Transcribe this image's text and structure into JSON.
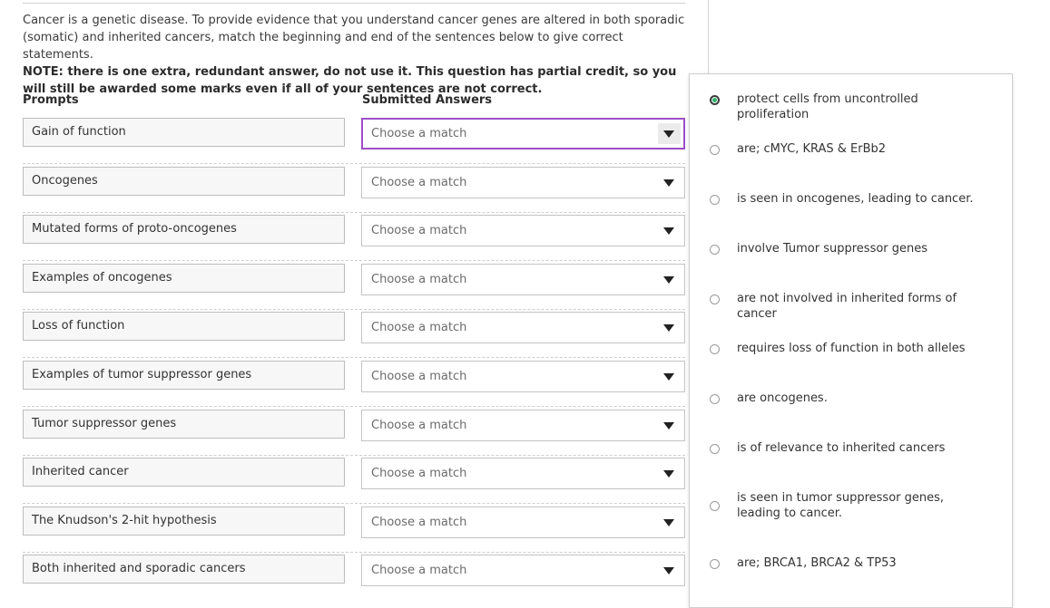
{
  "instructions": {
    "intro": "Cancer is a genetic disease. To provide evidence that you understand cancer genes are altered in both sporadic (somatic) and inherited cancers, match the beginning and end of the sentences below to give correct statements.",
    "note": "NOTE: there is one extra, redundant answer, do not use it. This question has partial credit, so you will still be awarded some marks even if all of your sentences are not correct."
  },
  "headers": {
    "prompts": "Prompts",
    "answers": "Submitted Answers"
  },
  "rows": [
    {
      "prompt": "Gain of function",
      "selected": "Choose a match"
    },
    {
      "prompt": "Oncogenes",
      "selected": "Choose a match"
    },
    {
      "prompt": "Mutated forms of proto-oncogenes",
      "selected": "Choose a match"
    },
    {
      "prompt": "Examples of oncogenes",
      "selected": "Choose a match"
    },
    {
      "prompt": "Loss of function",
      "selected": "Choose a match"
    },
    {
      "prompt": "Examples of tumor suppressor genes",
      "selected": "Choose a match"
    },
    {
      "prompt": "Tumor suppressor genes",
      "selected": "Choose a match"
    },
    {
      "prompt": "Inherited cancer",
      "selected": "Choose a match"
    },
    {
      "prompt": "The Knudson's 2-hit hypothesis",
      "selected": "Choose a match"
    },
    {
      "prompt": "Both inherited and sporadic cancers",
      "selected": "Choose a match"
    }
  ],
  "dropdown": {
    "selected_index": 0,
    "options": [
      "protect cells from uncontrolled proliferation",
      "are; cMYC, KRAS & ErBb2",
      "is seen in oncogenes, leading to cancer.",
      "involve Tumor suppressor genes",
      "are not involved in inherited forms of cancer",
      "requires loss of function in both alleles",
      "are oncogenes.",
      "is of relevance to inherited cancers",
      "is seen in tumor suppressor genes, leading to cancer.",
      "are; BRCA1, BRCA2 & TP53"
    ]
  },
  "colors": {
    "focus_border": "#9c4fc7",
    "radio_selected": "#2fb36a"
  }
}
